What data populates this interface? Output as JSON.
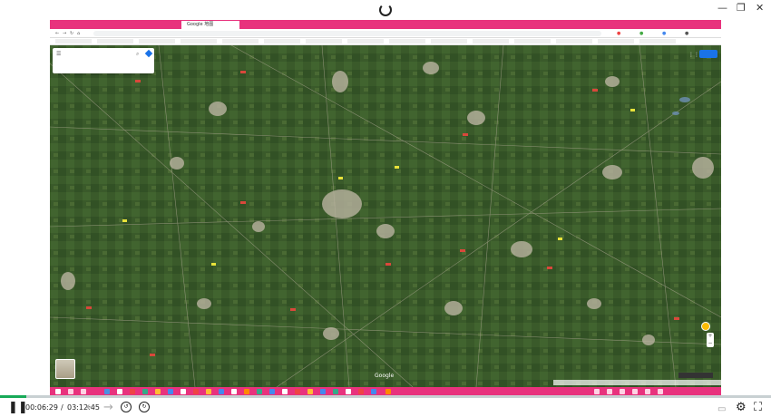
{
  "player": {
    "time_current": "00:06:29",
    "time_separator": "/",
    "time_total": "03:12:45",
    "progress_fraction": 0.034,
    "progress_color": "#18a958",
    "minimize_icon": "minimize-icon",
    "restore_icon": "restore-icon",
    "close_icon": "close-icon",
    "play_pause_icon": "pause-icon",
    "prev_icon": "arrow-left-icon",
    "next_icon": "arrow-right-icon",
    "rewind_icon": "rewind-15-icon",
    "forward_icon": "forward-15-icon",
    "caption_icon": "caption-icon",
    "settings_icon": "gear-icon",
    "fullscreen_icon": "fullscreen-icon"
  },
  "screen": {
    "accent_color": "#e8327d",
    "tabs": [
      {
        "label": "Google 地图",
        "active": true
      }
    ],
    "map": {
      "watermark": "Google",
      "search_menu_icon": "menu-icon",
      "search_icon": "search-icon",
      "directions_icon": "directions-icon",
      "layer_icon": "layers-icon",
      "pegman_icon": "pegman-icon",
      "apps_icon": "apps-grid-icon",
      "zoom_in": "+",
      "zoom_out": "−"
    }
  }
}
